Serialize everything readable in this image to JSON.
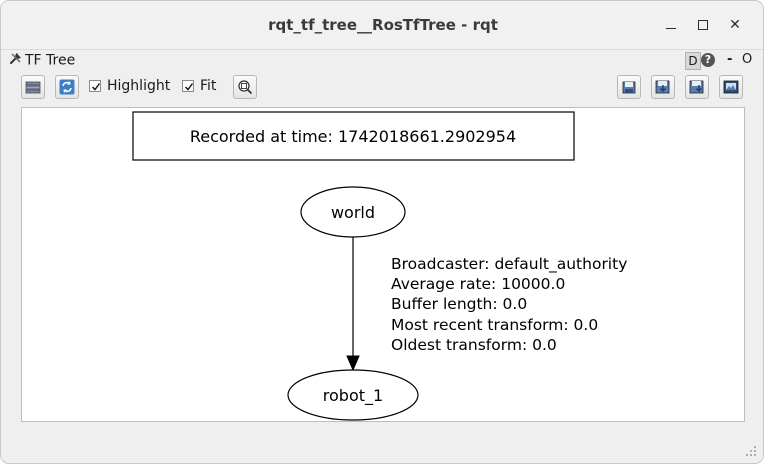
{
  "window": {
    "title": "rqt_tf_tree__RosTfTree - rqt"
  },
  "window_controls": {
    "minimize_icon": "minimize-icon",
    "maximize_icon": "maximize-icon",
    "close_label": "✕"
  },
  "plugin": {
    "title": "TF Tree",
    "d_label": "D",
    "help_label": "?",
    "dash_label": "-",
    "o_label": "O"
  },
  "toolbar": {
    "highlight_label": "Highlight",
    "highlight_checked": true,
    "fit_label": "Fit",
    "fit_checked": true
  },
  "graph": {
    "recorded_at": "Recorded at time: 1742018661.2902954",
    "nodes": [
      {
        "id": "world",
        "label": "world"
      },
      {
        "id": "robot_1",
        "label": "robot_1"
      }
    ],
    "edge": {
      "from": "world",
      "to": "robot_1",
      "lines": [
        "Broadcaster: default_authority",
        "Average rate: 10000.0",
        "Buffer length: 0.0",
        "Most recent transform: 0.0",
        "Oldest transform: 0.0"
      ]
    }
  }
}
